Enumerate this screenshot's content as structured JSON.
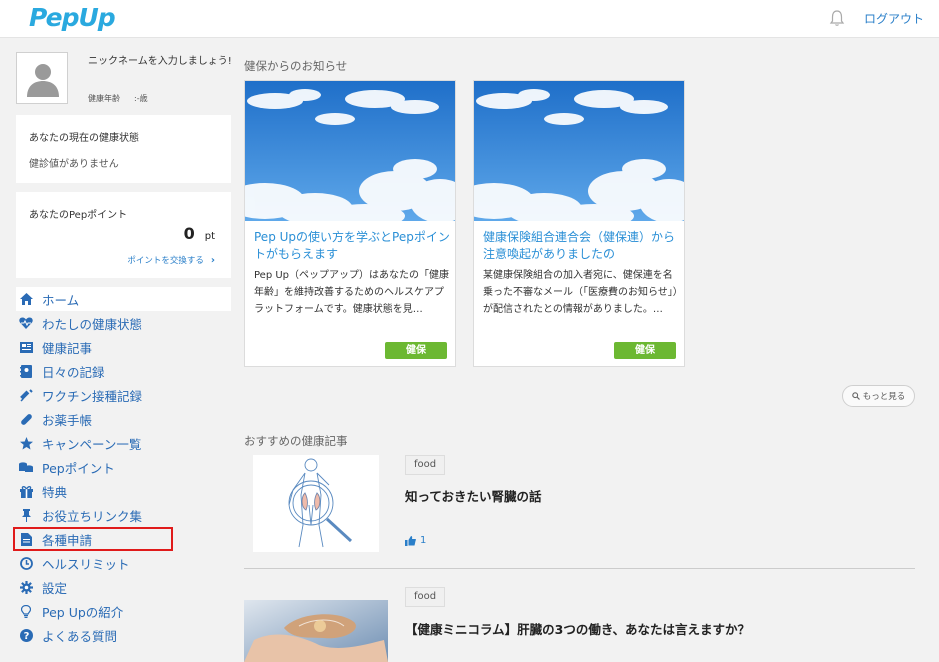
{
  "header": {
    "logo_text": "PepUp",
    "logout_label": "ログアウト"
  },
  "profile": {
    "nickname_prompt": "ニックネームを入力しましょう!",
    "age_label": "健康年齢",
    "age_value": ":-歳"
  },
  "health_status": {
    "title": "あなたの現在の健康状態",
    "message": "健診値がありません"
  },
  "points": {
    "title": "あなたのPepポイント",
    "value": "0",
    "unit": "pt",
    "exchange_link": "ポイントを交換する"
  },
  "nav": {
    "items": [
      {
        "label": "ホーム",
        "icon": "home-icon"
      },
      {
        "label": "わたしの健康状態",
        "icon": "heartbeat-icon"
      },
      {
        "label": "健康記事",
        "icon": "newspaper-icon"
      },
      {
        "label": "日々の記録",
        "icon": "notebook-icon"
      },
      {
        "label": "ワクチン接種記録",
        "icon": "syringe-icon"
      },
      {
        "label": "お薬手帳",
        "icon": "pill-icon"
      },
      {
        "label": "キャンペーン一覧",
        "icon": "star-icon"
      },
      {
        "label": "Pepポイント",
        "icon": "coins-icon"
      },
      {
        "label": "特典",
        "icon": "gift-icon"
      },
      {
        "label": "お役立ちリンク集",
        "icon": "pin-icon"
      },
      {
        "label": "各種申請",
        "icon": "document-icon"
      },
      {
        "label": "ヘルスリミット",
        "icon": "clock-icon"
      },
      {
        "label": "設定",
        "icon": "gear-icon"
      },
      {
        "label": "Pep Upの紹介",
        "icon": "lightbulb-icon"
      },
      {
        "label": "よくある質問",
        "icon": "question-icon"
      }
    ]
  },
  "news": {
    "section_title": "健保からのお知らせ",
    "cards": [
      {
        "title": "Pep Upの使い方を学ぶとPepポイントがもらえます",
        "body": "Pep Up（ペップアップ）はあなたの「健康年齢」を維持改善するためのヘルスケアプラットフォームです。健康状態を見…",
        "tag": "健保"
      },
      {
        "title": "健康保険組合連合会（健保連）から注意喚起がありましたの",
        "body": "某健康保険組合の加入者宛に、健保連を名乗った不審なメール（「医療費のお知らせ」）が配信されたとの情報がありました。…",
        "tag": "健保"
      }
    ],
    "more_label": "もっと見る"
  },
  "articles": {
    "section_title": "おすすめの健康記事",
    "items": [
      {
        "tag": "food",
        "title": "知っておきたい腎臓の話",
        "likes": "1"
      },
      {
        "tag": "food",
        "title": "【健康ミニコラム】肝臓の3つの働き、あなたは言えますか？"
      }
    ]
  },
  "colors": {
    "brand": "#2aa9df",
    "link": "#2a6bb5",
    "tag_green": "#6cb832",
    "highlight_red": "#e01b1b"
  }
}
